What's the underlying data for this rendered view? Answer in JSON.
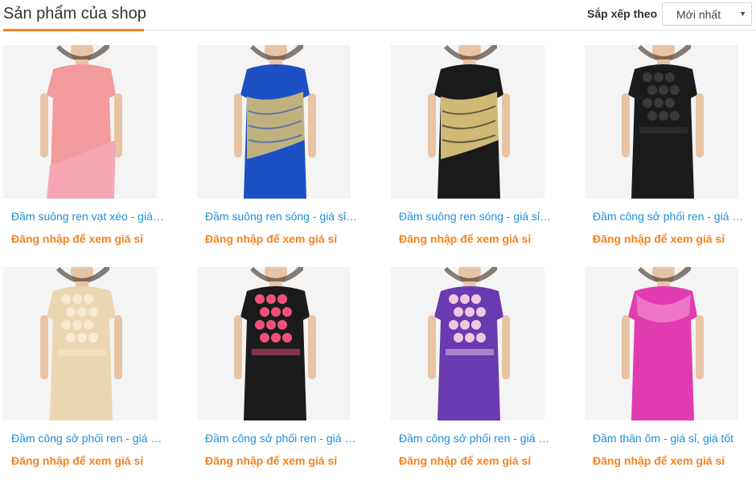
{
  "header": {
    "title": "Sản phẩm của shop",
    "sort_label": "Sắp xếp theo",
    "sort_value": "Mới nhất"
  },
  "colors": {
    "accent": "#f5821f",
    "link": "#1f8dd6"
  },
  "products": [
    {
      "name": "Đầm suông ren vạt xéo - giá sỉ, giá tốt",
      "price_text": "Đăng nhập để xem giá sỉ",
      "dress": "#f29a9c",
      "lace": "#f4a5b5",
      "style": "diag"
    },
    {
      "name": "Đầm suông ren sóng - giá sỉ, giá tốt",
      "price_text": "Đăng nhập để xem giá sỉ",
      "dress": "#1d4fc4",
      "lace": "#c9b77a",
      "style": "wave"
    },
    {
      "name": "Đầm suông ren sóng - giá sỉ, giá tốt",
      "price_text": "Đăng nhập để xem giá sỉ",
      "dress": "#1a1a1a",
      "lace": "#d9c27a",
      "style": "wave"
    },
    {
      "name": "Đầm công sở phối ren - giá sỉ, giá tốt",
      "price_text": "Đăng nhập để xem giá sỉ",
      "dress": "#1b1b1b",
      "lace": "#3a3a3a",
      "style": "flower"
    },
    {
      "name": "Đầm công sở phối ren - giá sỉ, giá tốt",
      "price_text": "Đăng nhập để xem giá sỉ",
      "dress": "#ead6b0",
      "lace": "#f6ead2",
      "style": "flower"
    },
    {
      "name": "Đầm công sở phối ren - giá sỉ, giá tốt",
      "price_text": "Đăng nhập để xem giá sỉ",
      "dress": "#1b1b1b",
      "lace": "#f0507a",
      "style": "flower"
    },
    {
      "name": "Đầm công sở phối ren - giá sỉ, giá tốt",
      "price_text": "Đăng nhập để xem giá sỉ",
      "dress": "#6a3ab0",
      "lace": "#f2c7e0",
      "style": "flower"
    },
    {
      "name": "Đầm thân ôm - giá sỉ, giá tốt",
      "price_text": "Đăng nhập để xem giá sỉ",
      "dress": "#e03cb0",
      "lace": "#f07bc8",
      "style": "sheer"
    }
  ]
}
